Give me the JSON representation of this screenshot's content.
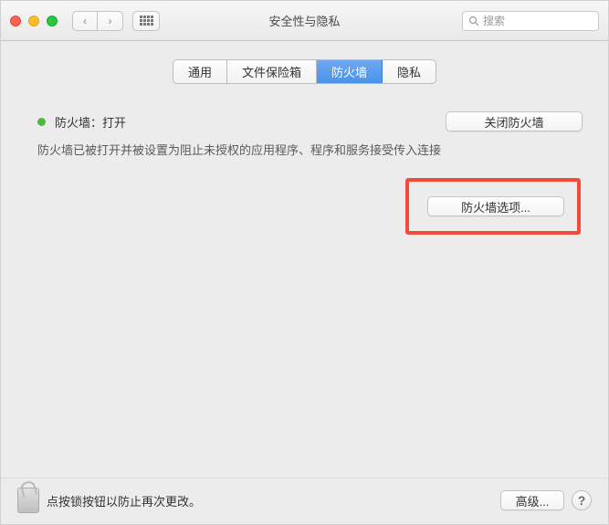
{
  "window": {
    "title": "安全性与隐私"
  },
  "toolbar": {
    "back": "‹",
    "forward": "›"
  },
  "search": {
    "placeholder": "搜索"
  },
  "tabs": [
    {
      "label": "通用",
      "active": false
    },
    {
      "label": "文件保险箱",
      "active": false
    },
    {
      "label": "防火墙",
      "active": true
    },
    {
      "label": "隐私",
      "active": false
    }
  ],
  "firewall": {
    "status_label": "防火墙：打开",
    "close_btn": "关闭防火墙",
    "description": "防火墙已被打开并被设置为阻止未授权的应用程序、程序和服务接受传入连接",
    "options_btn": "防火墙选项..."
  },
  "footer": {
    "lock_text": "点按锁按钮以防止再次更改。",
    "advanced_btn": "高级...",
    "help": "?"
  }
}
